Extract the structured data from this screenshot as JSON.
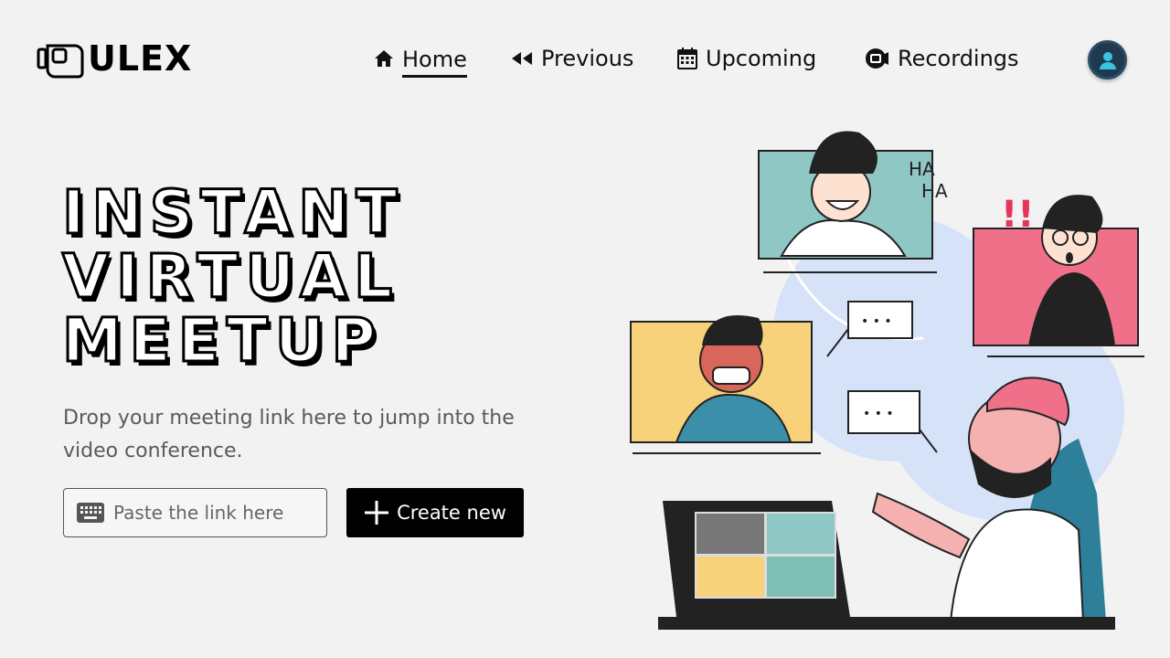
{
  "brand": {
    "name": "ULEX"
  },
  "nav": {
    "items": [
      {
        "label": "Home",
        "icon": "home-icon",
        "active": true
      },
      {
        "label": "Previous",
        "icon": "rewind-icon",
        "active": false
      },
      {
        "label": "Upcoming",
        "icon": "calendar-icon",
        "active": false
      },
      {
        "label": "Recordings",
        "icon": "video-camera-icon",
        "active": false
      }
    ]
  },
  "hero": {
    "title_lines": [
      "INSTANT",
      "VIRTUAL",
      "MEETUP"
    ],
    "description": "Drop your meeting link here to jump into the video conference.",
    "link_input": {
      "placeholder": "Paste the link here",
      "value": ""
    },
    "create_button": "Create new"
  },
  "illustration": {
    "laugh_text_1": "HA",
    "laugh_text_2": "HA",
    "exclaim": "!!",
    "bubble_1": "• • •",
    "bubble_2": "• • •"
  },
  "colors": {
    "background": "#f2f2f2",
    "accent_dark": "#000000",
    "tile_teal": "#8fc7c4",
    "tile_pink": "#f0708a",
    "tile_yellow": "#f8d27a",
    "bubble_blue": "#d6e2f7"
  }
}
